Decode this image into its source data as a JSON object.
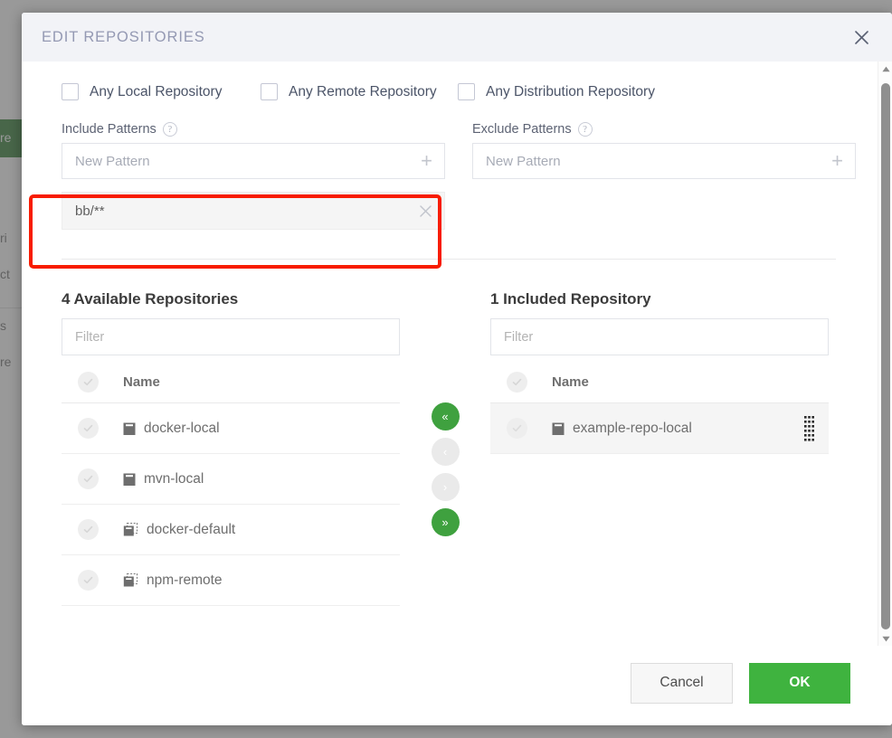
{
  "modal": {
    "title": "EDIT REPOSITORIES",
    "close_icon": "close-icon"
  },
  "any_repository": {
    "options": [
      {
        "label": "Any Local Repository",
        "checked": false
      },
      {
        "label": "Any Remote Repository",
        "checked": false
      },
      {
        "label": "Any Distribution Repository",
        "checked": false
      }
    ]
  },
  "patterns": {
    "include": {
      "label": "Include Patterns",
      "help_icon": "help-icon",
      "placeholder": "New Pattern",
      "add_icon": "plus-icon",
      "chips": [
        {
          "value": "bb/**",
          "remove_icon": "close-icon"
        }
      ]
    },
    "exclude": {
      "label": "Exclude Patterns",
      "help_icon": "help-icon",
      "placeholder": "New Pattern",
      "add_icon": "plus-icon",
      "chips": []
    }
  },
  "picker": {
    "available": {
      "title": "4 Available Repositories",
      "filter_placeholder": "Filter",
      "column_header": "Name",
      "rows": [
        {
          "name": "docker-local",
          "icon": "local-repo-icon",
          "selected": false
        },
        {
          "name": "mvn-local",
          "icon": "local-repo-icon",
          "selected": false
        },
        {
          "name": "docker-default",
          "icon": "remote-repo-icon",
          "selected": false
        },
        {
          "name": "npm-remote",
          "icon": "remote-repo-icon",
          "selected": false
        }
      ]
    },
    "included": {
      "title": "1 Included Repository",
      "filter_placeholder": "Filter",
      "column_header": "Name",
      "rows": [
        {
          "name": "example-repo-local",
          "icon": "local-repo-icon",
          "selected": true,
          "drag_icon": "drag-handle-icon"
        }
      ]
    },
    "transfer_buttons": [
      {
        "name": "move-all-left",
        "glyph": "«",
        "enabled": true
      },
      {
        "name": "move-left",
        "glyph": "‹",
        "enabled": false
      },
      {
        "name": "move-right",
        "glyph": "›",
        "enabled": false
      },
      {
        "name": "move-all-right",
        "glyph": "»",
        "enabled": true
      }
    ]
  },
  "footer": {
    "cancel_label": "Cancel",
    "ok_label": "OK"
  },
  "background_page": {
    "fragments": [
      "re",
      "ri",
      "ct",
      "s",
      "re"
    ]
  },
  "colors": {
    "accent_green": "#3fb33f",
    "header_bg": "#f2f3f7",
    "title_text": "#9499b3",
    "annotation_red": "#f81c00"
  }
}
